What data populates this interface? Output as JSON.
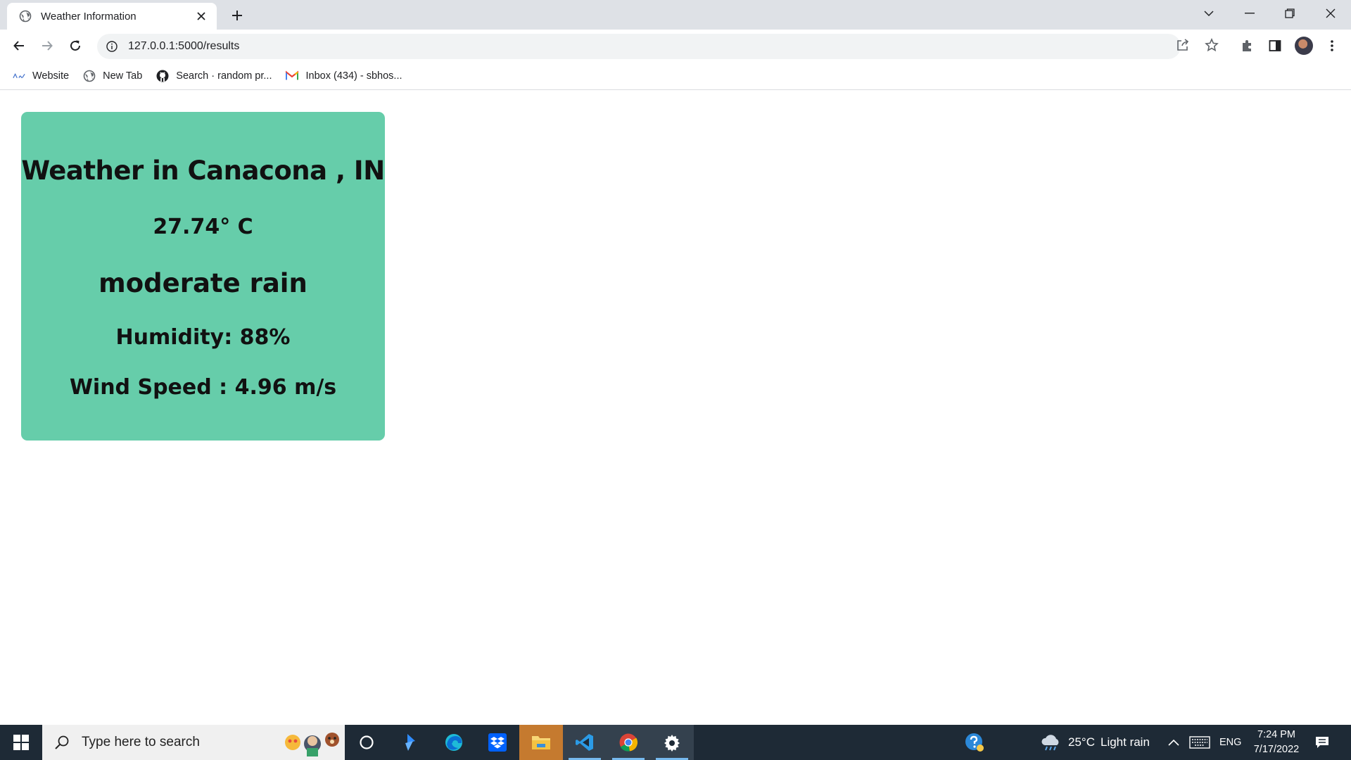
{
  "browser": {
    "tab": {
      "title": "Weather Information"
    },
    "address": {
      "url": "127.0.0.1:5000/results"
    },
    "bookmarks": [
      {
        "label": "Website",
        "icon": "aase-logo-icon"
      },
      {
        "label": "New Tab",
        "icon": "globe-icon"
      },
      {
        "label": "Search · random pr...",
        "icon": "github-icon"
      },
      {
        "label": "Inbox (434) - sbhos...",
        "icon": "gmail-icon"
      }
    ]
  },
  "weather": {
    "title": "Weather in Canacona , IN",
    "temperature": "27.74° C",
    "description": "moderate rain",
    "humidity": "Humidity: 88%",
    "wind_speed": "Wind Speed : 4.96 m/s",
    "card_color": "#66cdaa"
  },
  "taskbar": {
    "search_placeholder": "Type here to search",
    "weather_temp": "25°C",
    "weather_text": "Light rain",
    "language": "ENG",
    "time": "7:24 PM",
    "date": "7/17/2022",
    "background_color": "#1e2a36"
  }
}
